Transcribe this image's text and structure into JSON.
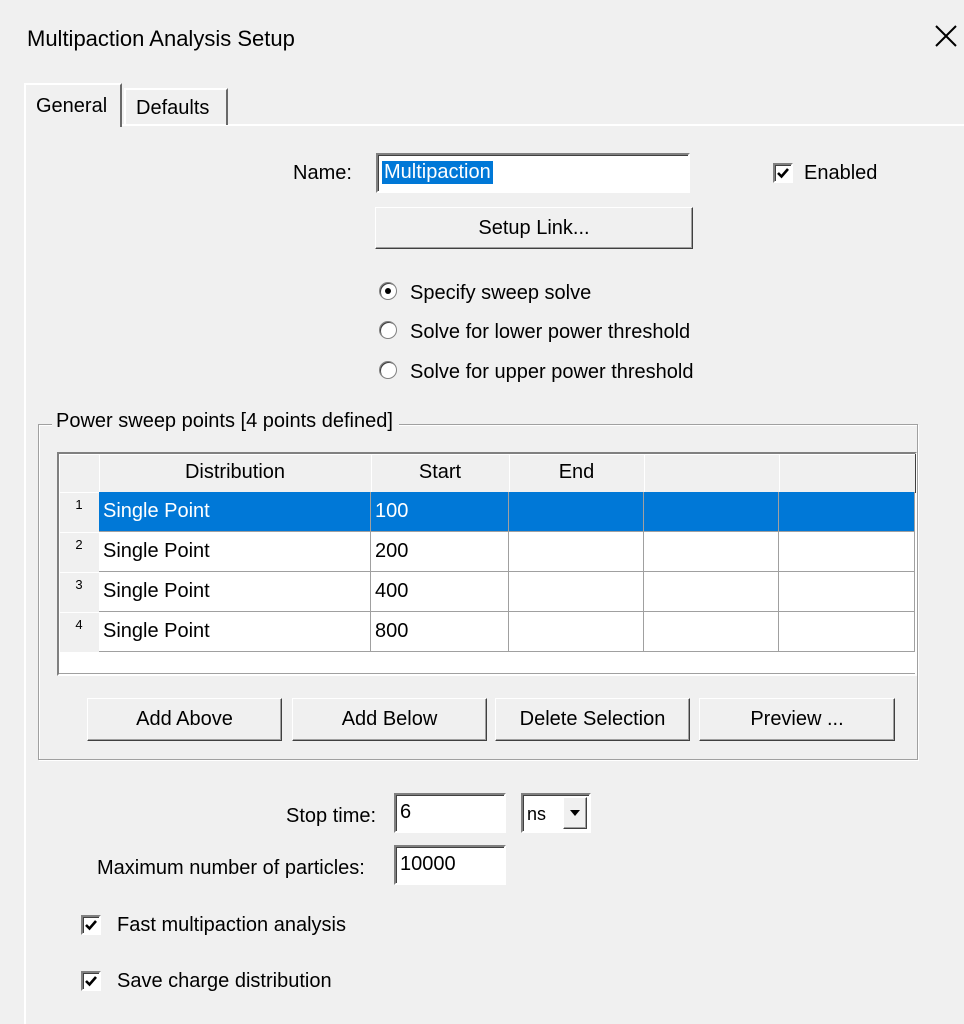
{
  "window": {
    "title": "Multipaction Analysis Setup"
  },
  "tabs": [
    {
      "label": "General"
    },
    {
      "label": "Defaults"
    }
  ],
  "general": {
    "name_label": "Name:",
    "name_value": "Multipaction",
    "enabled_label": "Enabled",
    "enabled_checked": true,
    "setup_link_label": "Setup Link...",
    "solve_options": [
      {
        "label": "Specify sweep solve",
        "selected": true
      },
      {
        "label": "Solve for lower power threshold",
        "selected": false
      },
      {
        "label": "Solve for upper power threshold",
        "selected": false
      }
    ],
    "sweep_group_label": "Power sweep points [4 points defined]",
    "table": {
      "columns": [
        "Distribution",
        "Start",
        "End",
        "",
        ""
      ],
      "rows": [
        {
          "index": "1",
          "distribution": "Single Point",
          "start": "100",
          "end": "",
          "selected": true
        },
        {
          "index": "2",
          "distribution": "Single Point",
          "start": "200",
          "end": "",
          "selected": false
        },
        {
          "index": "3",
          "distribution": "Single Point",
          "start": "400",
          "end": "",
          "selected": false
        },
        {
          "index": "4",
          "distribution": "Single Point",
          "start": "800",
          "end": "",
          "selected": false
        }
      ]
    },
    "buttons": {
      "add_above": "Add Above",
      "add_below": "Add Below",
      "delete_selection": "Delete Selection",
      "preview": "Preview ..."
    },
    "stop_time_label": "Stop time:",
    "stop_time_value": "6",
    "stop_time_unit": "ns",
    "max_particles_label": "Maximum number of particles:",
    "max_particles_value": "10000",
    "fast_analysis_label": "Fast multipaction analysis",
    "fast_analysis_checked": true,
    "save_charge_label": "Save charge distribution",
    "save_charge_checked": true
  },
  "colors": {
    "selection": "#0078d7",
    "face": "#f0f0f0"
  },
  "icons": {
    "close": "close-icon",
    "dropdown": "chevron-down-icon",
    "check": "check-icon"
  }
}
